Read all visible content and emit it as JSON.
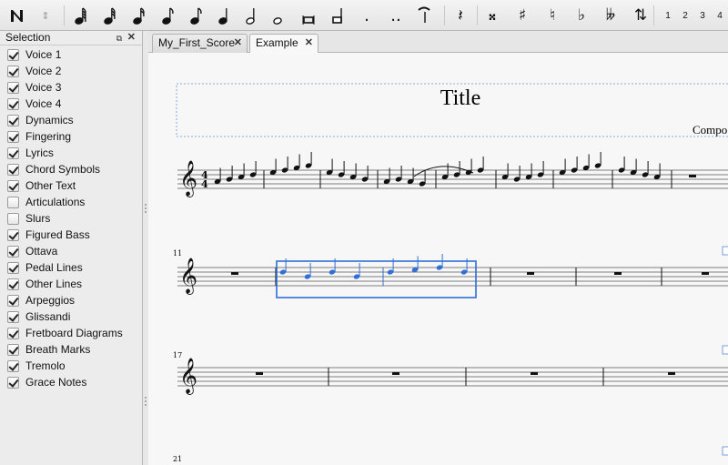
{
  "toolbar": {
    "note_input_icon": "note-input-icon",
    "duration_icons": [
      "64th-note-icon",
      "32nd-note-icon",
      "16th-note-icon",
      "8th-note-icon",
      "quarter-note-icon",
      "half-note-icon",
      "whole-note-icon",
      "breve-icon",
      "longa-icon"
    ],
    "augmentation_dot": ".",
    "double_augmentation_dot": "..",
    "accidental_icons": [
      "double-sharp-icon",
      "sharp-icon",
      "natural-icon",
      "flat-icon",
      "double-flat-icon",
      "flip-direction-icon"
    ],
    "voices": [
      "1",
      "2",
      "3",
      "4"
    ]
  },
  "panel": {
    "title": "Selection",
    "items": [
      {
        "label": "Voice 1",
        "checked": true
      },
      {
        "label": "Voice 2",
        "checked": true
      },
      {
        "label": "Voice 3",
        "checked": true
      },
      {
        "label": "Voice 4",
        "checked": true
      },
      {
        "label": "Dynamics",
        "checked": true
      },
      {
        "label": "Fingering",
        "checked": true
      },
      {
        "label": "Lyrics",
        "checked": true
      },
      {
        "label": "Chord Symbols",
        "checked": true
      },
      {
        "label": "Other Text",
        "checked": true
      },
      {
        "label": "Articulations",
        "checked": false
      },
      {
        "label": "Slurs",
        "checked": false
      },
      {
        "label": "Figured Bass",
        "checked": true
      },
      {
        "label": "Ottava",
        "checked": true
      },
      {
        "label": "Pedal Lines",
        "checked": true
      },
      {
        "label": "Other Lines",
        "checked": true
      },
      {
        "label": "Arpeggios",
        "checked": true
      },
      {
        "label": "Glissandi",
        "checked": true
      },
      {
        "label": "Fretboard Diagrams",
        "checked": true
      },
      {
        "label": "Breath Marks",
        "checked": true
      },
      {
        "label": "Tremolo",
        "checked": true
      },
      {
        "label": "Grace Notes",
        "checked": true
      }
    ]
  },
  "tabs": [
    {
      "label": "My_First_Score",
      "active": false
    },
    {
      "label": "Example",
      "active": true
    }
  ],
  "score": {
    "title": "Title",
    "composer": "Compo",
    "time_signature": {
      "top": "4",
      "bottom": "4"
    },
    "measure_numbers": [
      "11",
      "17",
      "21"
    ],
    "selection_color": "#2f6fd6"
  }
}
